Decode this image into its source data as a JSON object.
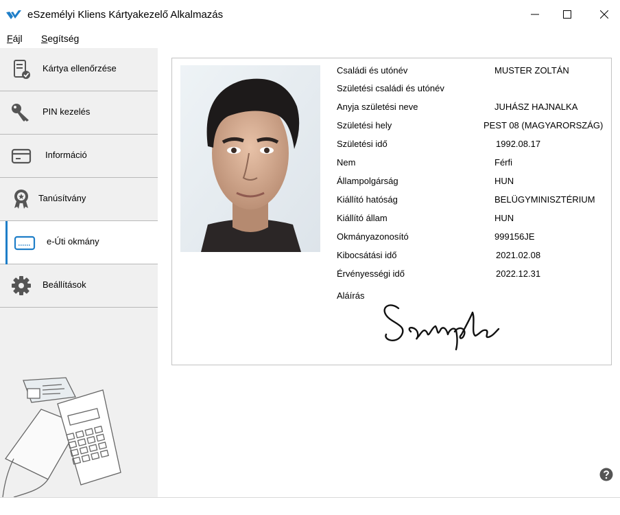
{
  "window": {
    "title": "eSzemélyi Kliens Kártyakezelő Alkalmazás",
    "brand_color": "#1e7ec8"
  },
  "menu": [
    {
      "label": "Fájl",
      "icon": ""
    },
    {
      "label": "Segítség",
      "icon": ""
    }
  ],
  "sidebar": {
    "items": [
      {
        "label": "Kártya ellenőrzése",
        "icon": "card-check-icon"
      },
      {
        "label": "PIN kezelés",
        "icon": "key-icon"
      },
      {
        "label": "Információ",
        "icon": "card-info-icon"
      },
      {
        "label": "Tanúsítvány",
        "icon": "certificate-icon"
      },
      {
        "label": "e-Úti okmány",
        "icon": "passport-chip-icon",
        "active": true
      },
      {
        "label": "Beállítások",
        "icon": "gear-icon"
      }
    ]
  },
  "document": {
    "fields": [
      {
        "label": "Családi és utónév",
        "value": "MUSTER ZOLTÁN"
      },
      {
        "label": "Születési családi és utónév",
        "value": ""
      },
      {
        "label": "Anyja születési neve",
        "value": "JUHÁSZ HAJNALKA"
      },
      {
        "label": "Születési hely",
        "value": "PEST 08 (MAGYARORSZÁG)"
      },
      {
        "label": "Születési idő",
        "value": "1992.08.17"
      },
      {
        "label": "Nem",
        "value": "Férfi"
      },
      {
        "label": "Állampolgárság",
        "value": "HUN"
      },
      {
        "label": "Kiállító hatóság",
        "value": "BELÜGYMINISZTÉRIUM"
      },
      {
        "label": "Kiállító állam",
        "value": "HUN"
      },
      {
        "label": "Okmányazonosító",
        "value": "999156JE"
      },
      {
        "label": "Kibocsátási idő",
        "value": "2021.02.08"
      },
      {
        "label": "Érvényességi idő",
        "value": "2022.12.31"
      }
    ],
    "signature_label": "Aláírás",
    "signature_text": "Sample"
  }
}
